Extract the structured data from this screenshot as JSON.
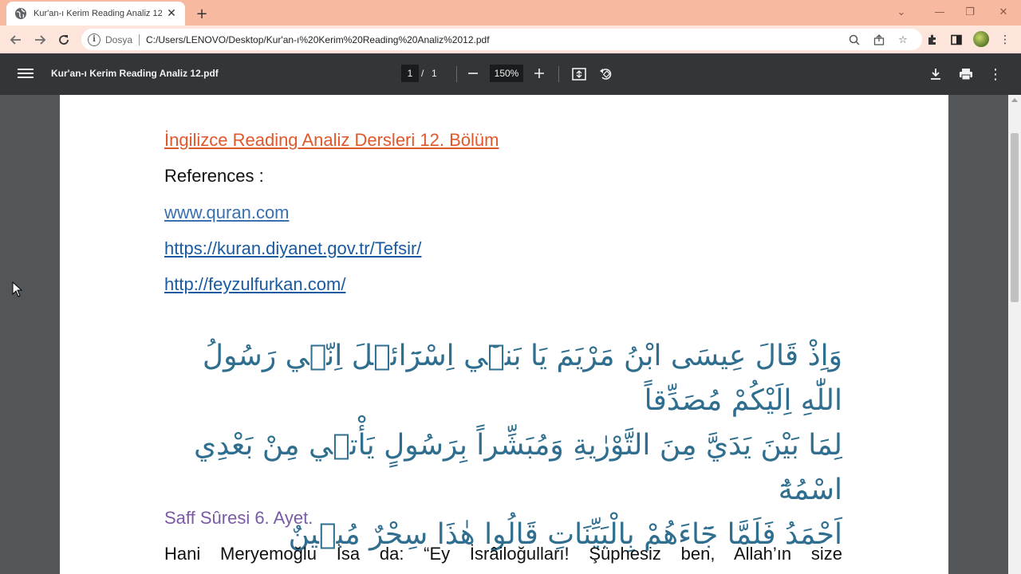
{
  "browser": {
    "tab_title": "Kur'an-ı Kerim Reading Analiz 12",
    "new_tab_label": "+",
    "address": {
      "scheme_label": "Dosya",
      "url": "C:/Users/LENOVO/Desktop/Kur'an-ı%20Kerim%20Reading%20Analiz%2012.pdf"
    },
    "colors": {
      "tabstrip": "#f7b9a0",
      "toolbar": "#fde5dc"
    }
  },
  "pdf_viewer": {
    "doc_name": "Kur'an-ı Kerim Reading Analiz 12.pdf",
    "current_page": "1",
    "page_separator": "/",
    "total_pages": "1",
    "zoom": "150%"
  },
  "document": {
    "heading": "İngilizce Reading Analiz Dersleri 12. Bölüm",
    "references_label": "References :",
    "links": [
      "www.quran.com",
      "https://kuran.diyanet.gov.tr/Tefsir/",
      "http://feyzulfurkan.com/"
    ],
    "arabic_lines": [
      "وَاِذْ قَالَ عِيسَى ابْنُ مَرْيَمَ يَا بَنٖٓي اِسْرَٓائٖلَ اِنّٖي رَسُولُ اللّٰهِ اِلَيْكُمْ مُصَدِّقاً",
      "لِمَا بَيْنَ يَدَيَّ مِنَ التَّوْرٰيةِ وَمُبَشِّراً بِرَسُولٍ يَأْتٖي مِنْ بَعْدِي اسْمُهُٓ",
      "اَحْمَدُ فَلَمَّا جَٓاءَهُمْ بِالْبَيِّنَاتِ قَالُوا هٰذَا سِحْرٌ مُبٖينٌ"
    ],
    "sura_ref": "Saff Sûresi 6. Ayet.",
    "translation_line": "Hani Meryemoğlu İsa da: “Ey İsrâiloğulları! Şüphesiz ben, Allah’ın size"
  }
}
